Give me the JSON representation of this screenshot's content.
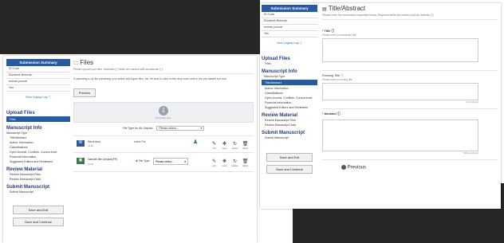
{
  "sidebar": {
    "title": "Submission Summary",
    "rows": [
      "ID Code",
      "Elizabeth Brennan",
      "rennan.journal",
      "Yes"
    ],
    "view_link": "View Legacy Log ⓘ"
  },
  "menu": {
    "upload_header": "Upload Files",
    "files_item": "Files",
    "manuscript_header": "Manuscript Info",
    "manuscript_items": [
      "Manuscript Type",
      "Title/Abstract",
      "Author Information",
      "Classifications",
      "Open Access, Conflicts, Concurrence",
      "Financial Information",
      "Suggested Editors and Reviewers"
    ],
    "review_header": "Review Material",
    "review_items": [
      "Review Manuscript Files",
      "Review Manuscript Data"
    ],
    "submit_header": "Submit Manuscript",
    "submit_item": "Submit Manuscript",
    "save_exit": "Save and Exit",
    "save_continue": "Save and Continue"
  },
  "files_page": {
    "title": "Files",
    "subtitle": "Please upload your files. Asterisks (*) fields are marked with an asterisk (*).",
    "description": "If uploading a zip file containing your article and figure files, etc. be sure to click on the drop zone next to the pre-loaded box and",
    "preview_button": "Preview",
    "dropzone_label": "Drop files here",
    "file_type_label": "File Type for All Objects:",
    "file_type_value": "Please select...",
    "file1": {
      "name": "Word.docx",
      "size": "11 kb",
      "col": "article File"
    },
    "file2": {
      "name": "Intashell-title-Uploads(PP)",
      "size": "11 kb",
      "type_label": "File Type",
      "type_value": "Please select..."
    },
    "actions": [
      "edit",
      "move",
      "replace",
      "delete"
    ]
  },
  "title_page": {
    "title": "Title/Abstract",
    "subtitle": "Please enter the information requested below. Required fields are marked with an asterisk (*).",
    "title_label": "* Title ⓘ",
    "title_hint": "Please enter a manuscript title",
    "running_label": "Running Title ⓘ",
    "running_hint": "Please enter a running title",
    "counter1": "0 words left",
    "abstract_label": "* Abstract ⓘ",
    "counter2": "500 words left",
    "previous": "Previous"
  }
}
